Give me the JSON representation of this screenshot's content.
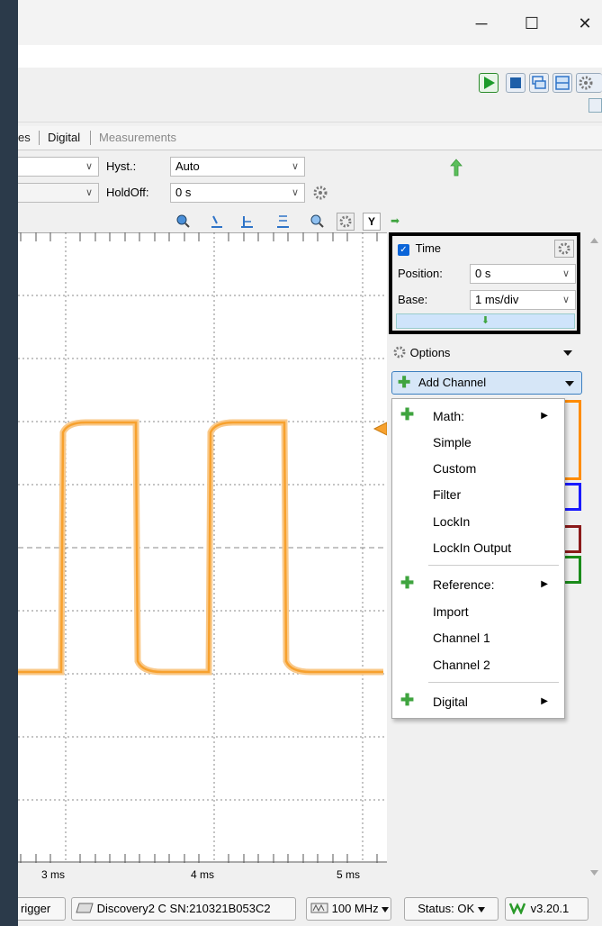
{
  "window": {
    "minimize_glyph": "─",
    "maximize_glyph": "☐",
    "close_glyph": "✕"
  },
  "tabs": {
    "partial": "es",
    "digital": "Digital",
    "measurements": "Measurements"
  },
  "trigger": {
    "hyst_label": "Hyst.:",
    "hyst_value": "Auto",
    "holdoff_label": "HoldOff:",
    "holdoff_value": "0 s"
  },
  "plot_toolbar": {
    "y_label": "Y",
    "arrow": "➡"
  },
  "axis": {
    "ticks": [
      "3 ms",
      "4 ms",
      "5 ms"
    ]
  },
  "time_panel": {
    "title": "Time",
    "position_label": "Position:",
    "position_value": "0 s",
    "base_label": "Base:",
    "base_value": "1 ms/div",
    "down_arrow": "⬇"
  },
  "options_label": "Options",
  "add_channel_label": "Add Channel",
  "add_menu": {
    "math": "Math:",
    "simple": "Simple",
    "custom": "Custom",
    "filter": "Filter",
    "lockin": "LockIn",
    "lockin_output": "LockIn Output",
    "reference": "Reference:",
    "import": "Import",
    "channel1": "Channel 1",
    "channel2": "Channel 2",
    "digital": "Digital"
  },
  "status_bar": {
    "trigger_partial": "rigger",
    "device": "Discovery2 C SN:210321B053C2",
    "freq": "100 MHz",
    "status": "Status: OK",
    "version": "v3.20.1"
  },
  "colors": {
    "signal": "#f7a12e",
    "accent_blue": "#0a64d8",
    "ch_orange": "#ff8c00",
    "ch_blue": "#1a1aff",
    "ch_red": "#8b1a1a",
    "ch_green": "#1a8b1a"
  }
}
